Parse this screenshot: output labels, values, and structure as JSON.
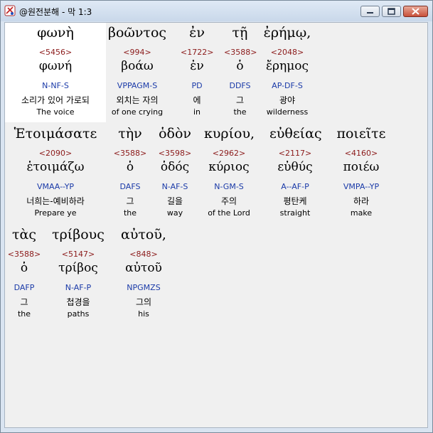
{
  "window": {
    "title": "@원전분해 - 막 1:3",
    "buttons": {
      "minimize": "minimize",
      "maximize": "maximize",
      "close": "close"
    },
    "icon": "app-logo-icon"
  },
  "rows": [
    {
      "words": [
        {
          "greek": "φωνὴ",
          "strong": "<5456>",
          "lemma": "φωνή",
          "parse": "N-NF-S",
          "korean": "소리가 있어 가로되",
          "english": "The voice",
          "selected": true
        },
        {
          "greek": "βοῶντος",
          "strong": "<994>",
          "lemma": "βοάω",
          "parse": "VPPAGM-S",
          "korean": "외치는 자의",
          "english": "of one crying",
          "selected": false
        },
        {
          "greek": "ἐν",
          "strong": "<1722>",
          "lemma": "ἐν",
          "parse": "PD",
          "korean": "에",
          "english": "in",
          "selected": false
        },
        {
          "greek": "τῇ",
          "strong": "<3588>",
          "lemma": "ὁ",
          "parse": "DDFS",
          "korean": "그",
          "english": "the",
          "selected": false
        },
        {
          "greek": "ἐρήμῳ,",
          "strong": "<2048>",
          "lemma": "ἔρημος",
          "parse": "AP-DF-S",
          "korean": "광야",
          "english": "wilderness",
          "selected": false
        }
      ]
    },
    {
      "words": [
        {
          "greek": "Ἑτοιμάσατε",
          "strong": "<2090>",
          "lemma": "ἑτοιμάζω",
          "parse": "VMAA--YP",
          "korean": "너희는-예비하라",
          "english": "Prepare ye",
          "selected": false
        },
        {
          "greek": "τὴν",
          "strong": "<3588>",
          "lemma": "ὁ",
          "parse": "DAFS",
          "korean": "그",
          "english": "the",
          "selected": false
        },
        {
          "greek": "ὁδὸν",
          "strong": "<3598>",
          "lemma": "ὁδός",
          "parse": "N-AF-S",
          "korean": "길을",
          "english": "way",
          "selected": false
        },
        {
          "greek": "κυρίου,",
          "strong": "<2962>",
          "lemma": "κύριος",
          "parse": "N-GM-S",
          "korean": "주의",
          "english": "of the Lord",
          "selected": false
        },
        {
          "greek": "εὐθείας",
          "strong": "<2117>",
          "lemma": "εὐθύς",
          "parse": "A--AF-P",
          "korean": "평탄케",
          "english": "straight",
          "selected": false
        },
        {
          "greek": "ποιεῖτε",
          "strong": "<4160>",
          "lemma": "ποιέω",
          "parse": "VMPA--YP",
          "korean": "하라",
          "english": "make",
          "selected": false
        }
      ]
    },
    {
      "words": [
        {
          "greek": "τὰς",
          "strong": "<3588>",
          "lemma": "ὁ",
          "parse": "DAFP",
          "korean": "그",
          "english": "the",
          "selected": false
        },
        {
          "greek": "τρίβους",
          "strong": "<5147>",
          "lemma": "τρίβος",
          "parse": "N-AF-P",
          "korean": "첩경을",
          "english": "paths",
          "selected": false
        },
        {
          "greek": "αὐτοῦ,",
          "strong": "<848>",
          "lemma": "αὐτοῦ",
          "parse": "NPGMZS",
          "korean": "그의",
          "english": "his",
          "selected": false
        }
      ]
    }
  ]
}
